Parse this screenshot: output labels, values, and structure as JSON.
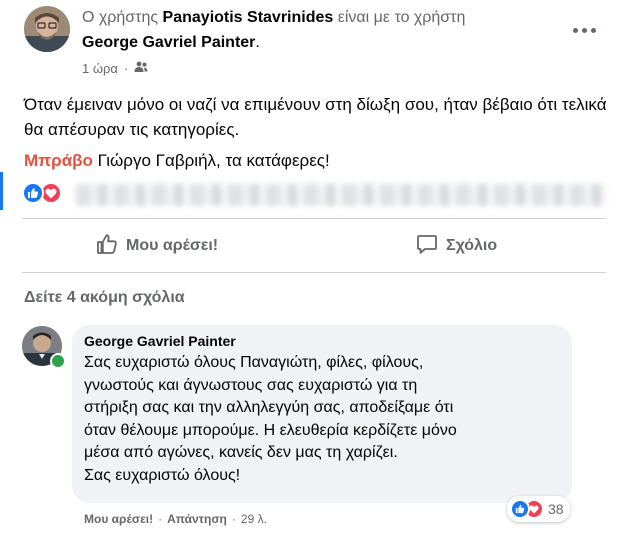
{
  "post": {
    "header": {
      "prefix": "Ο χρήστης",
      "author": "Panayiotis Stavrinides",
      "connector": "είναι με το χρήστη",
      "tagged": "George Gavriel Painter",
      "tagged_suffix": "."
    },
    "time": "1 ώρα",
    "audience_icon": "friends-icon",
    "more_icon": "more-options-icon",
    "text": "Όταν έμειναν μόνο οι ναζί να επιμένουν στη δίωξη σου, ήταν βέβαιο ότι τελικά θα απέσυραν τις κατηγορίες.",
    "highlight": "Μπράβο",
    "text2": " Γιώργο Γαβριήλ, τα κατάφερες!"
  },
  "actions": {
    "like_label": "Μου αρέσει!",
    "comment_label": "Σχόλιο"
  },
  "more_comments": "Δείτε 4 ακόμη σχόλια",
  "comment": {
    "author": "George Gavriel Painter",
    "lines": [
      "Σας ευχαριστώ όλους Παναγιώτη, φίλες, φίλους,",
      "γνωστούς και άγνωστους σας ευχαριστώ για τη",
      "στήριξη σας και την αλληλεγγύη σας, αποδείξαμε ότι",
      "όταν θέλουμε μπορούμε. Η ελευθερία κερδίζετε μόνο",
      "μέσα από αγώνες, κανείς δεν μας τη χαρίζει.",
      "Σας ευχαριστώ όλους!"
    ],
    "reaction_count": "38",
    "like_action": "Μου αρέσει!",
    "reply_action": "Απάντηση",
    "separator": "·",
    "time": "29 λ."
  },
  "colors": {
    "accent": "#1877f2",
    "love": "#f33e58",
    "highlight": "#e0533e",
    "online": "#31a24c",
    "muted": "#65676b"
  }
}
